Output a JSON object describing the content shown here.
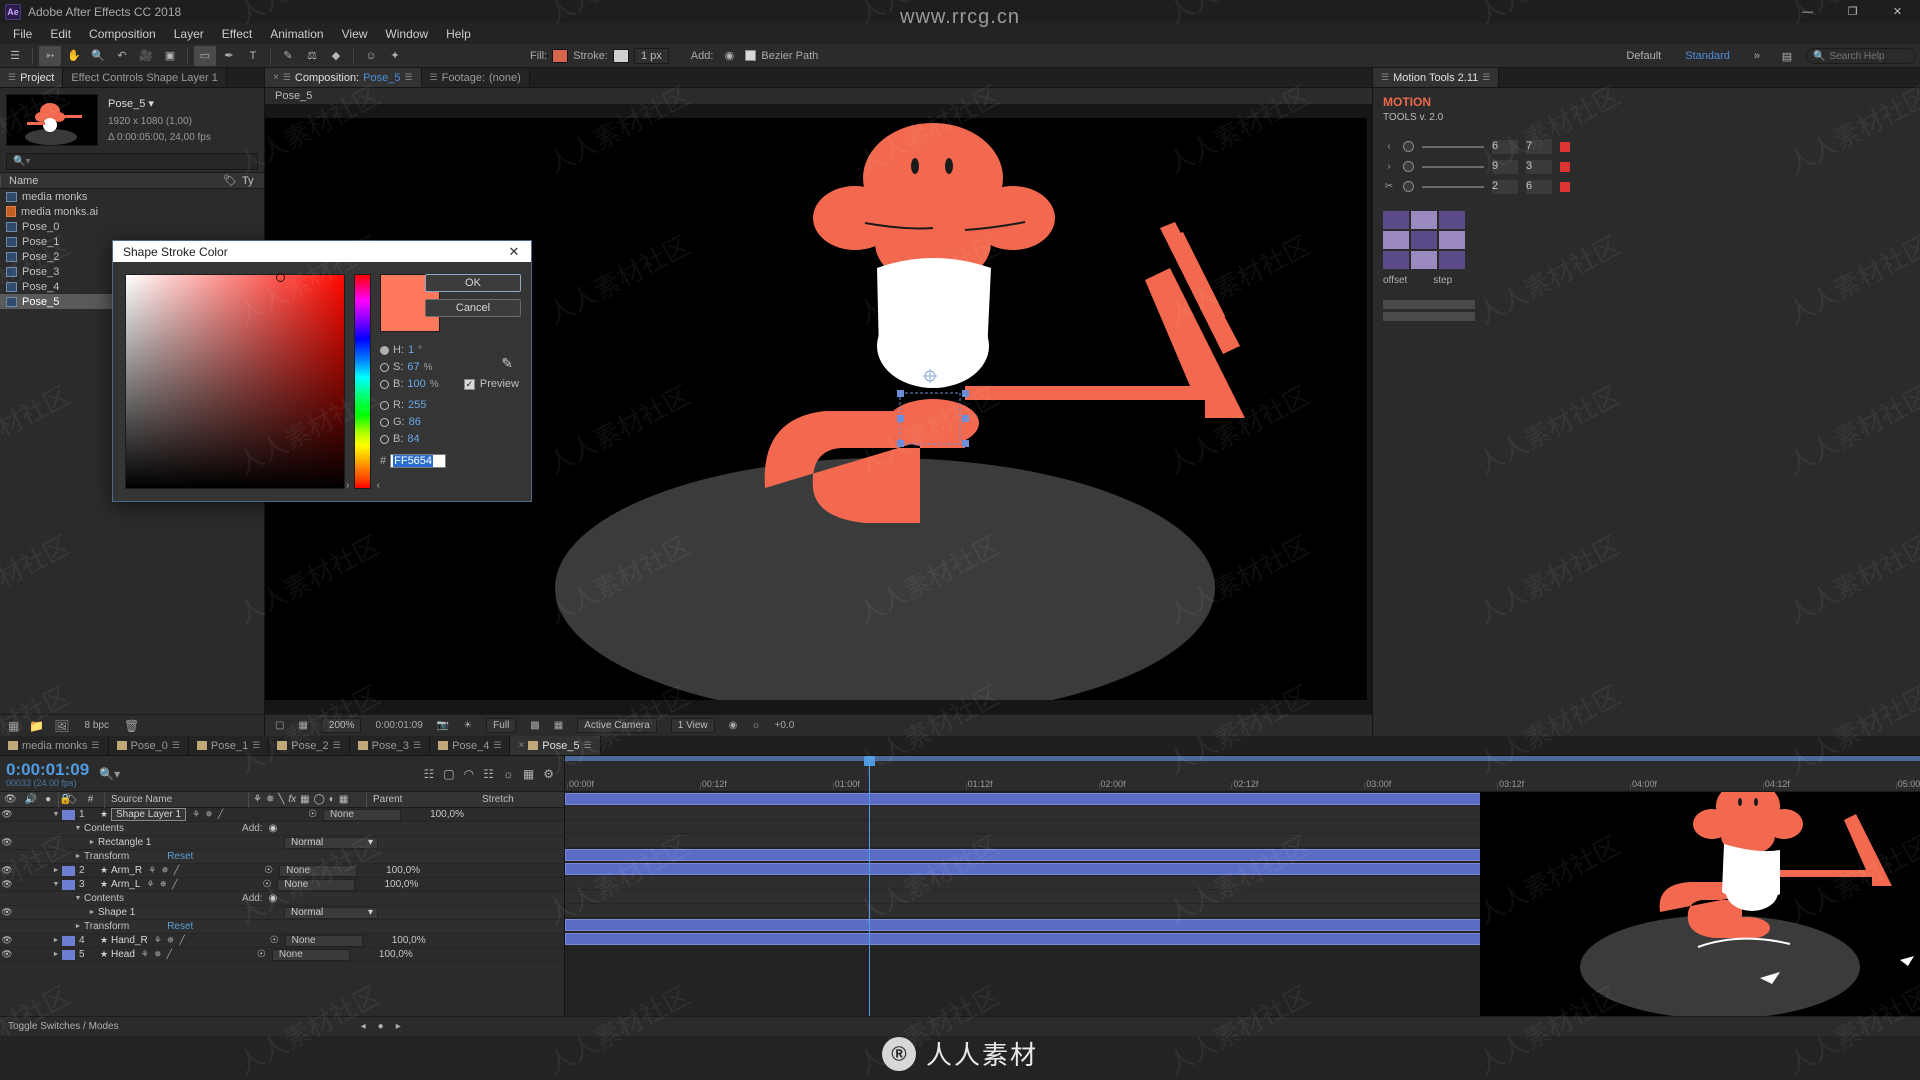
{
  "app": {
    "title": "Adobe After Effects CC 2018",
    "logo": "Ae",
    "window_buttons": {
      "minimize": "—",
      "maximize": "❐",
      "close": "✕"
    }
  },
  "menubar": {
    "items": [
      "File",
      "Edit",
      "Composition",
      "Layer",
      "Effect",
      "Animation",
      "View",
      "Window",
      "Help"
    ]
  },
  "toolbar": {
    "fill_label": "Fill:",
    "stroke_label": "Stroke:",
    "stroke_width": "1 px",
    "add_label": "Add:",
    "bezier_path": "Bezier Path",
    "fill_color": "#d4654f",
    "stroke_color": "#cfcfcf",
    "workspace_default": "Default",
    "workspace_standard": "Standard",
    "workspace_overflow": "»",
    "search_placeholder": "Search Help",
    "tools": [
      "selection-tool",
      "hand-tool",
      "zoom-tool",
      "rotation-tool",
      "camera-tool",
      "pan-behind-tool",
      "shape-tool",
      "pen-tool",
      "type-tool",
      "brush-tool",
      "clone-stamp-tool",
      "eraser-tool",
      "roto-brush-tool",
      "puppet-tool"
    ]
  },
  "project_panel": {
    "tabs": [
      {
        "label": "Project",
        "active": true
      },
      {
        "label": "Effect Controls Shape Layer 1",
        "active": false
      }
    ],
    "preview": {
      "name": "Pose_5",
      "dimensions": "1920 x 1080 (1,00)",
      "duration": "Δ 0:00:05:00, 24,00 fps"
    },
    "search_placeholder": "",
    "columns": {
      "name": "Name",
      "type": "Ty"
    },
    "items": [
      {
        "label": "media monks",
        "icon": "composition-icon",
        "selected": false
      },
      {
        "label": "media monks.ai",
        "icon": "illustrator-icon",
        "selected": false
      },
      {
        "label": "Pose_0",
        "icon": "composition-icon",
        "selected": false
      },
      {
        "label": "Pose_1",
        "icon": "composition-icon",
        "selected": false
      },
      {
        "label": "Pose_2",
        "icon": "composition-icon",
        "selected": false
      },
      {
        "label": "Pose_3",
        "icon": "composition-icon",
        "selected": false
      },
      {
        "label": "Pose_4",
        "icon": "composition-icon",
        "selected": false
      },
      {
        "label": "Pose_5",
        "icon": "composition-icon",
        "selected": true
      }
    ],
    "footer": {
      "bpc": "8 bpc"
    }
  },
  "comp_panel": {
    "tabs": [
      {
        "label": "Composition:",
        "name": "Pose_5",
        "active": true
      },
      {
        "label": "Footage:",
        "name": "(none)",
        "active": false
      }
    ],
    "breadcrumb": "Pose_5",
    "footer": {
      "magnification": "200%",
      "timecode": "0:00:01:09",
      "resolution": "Full",
      "view": "Active Camera",
      "views": "1 View",
      "exposure": "+0.0"
    }
  },
  "right_panel": {
    "tab_label": "Motion Tools 2.11",
    "title_line1": "MOTION",
    "title_line2": "TOOLS v. 2.0",
    "slider_rows": [
      {
        "arrow": "‹",
        "value_a": "6",
        "value_b": "7"
      },
      {
        "arrow": "›",
        "value_a": "9",
        "value_b": "3"
      },
      {
        "arrow": "✂",
        "value_a": "2",
        "value_b": "6"
      }
    ],
    "grid_labels": {
      "offset": "offset",
      "step": "step"
    }
  },
  "timeline": {
    "tabs": [
      {
        "label": "media monks",
        "active": false
      },
      {
        "label": "Pose_0",
        "active": false
      },
      {
        "label": "Pose_1",
        "active": false
      },
      {
        "label": "Pose_2",
        "active": false
      },
      {
        "label": "Pose_3",
        "active": false
      },
      {
        "label": "Pose_4",
        "active": false
      },
      {
        "label": "Pose_5",
        "active": true
      }
    ],
    "current_time": "0:00:01:09",
    "frames": "00033 (24.00 fps)",
    "columns": {
      "source_name": "Source Name",
      "parent": "Parent",
      "stretch": "Stretch",
      "hash": "#"
    },
    "ruler_ticks": [
      "00:00f",
      "00:12f",
      "01:00f",
      "01:12f",
      "02:00f",
      "02:12f",
      "03:00f",
      "03:12f",
      "04:00f",
      "04:12f",
      "05:00"
    ],
    "rows": [
      {
        "kind": "layer",
        "index": "1",
        "name": "Shape Layer 1",
        "parent": "None",
        "stretch": "100,0%",
        "expanded": true,
        "selected": true,
        "boxed": true
      },
      {
        "kind": "group",
        "label": "Contents",
        "add_label": "Add:",
        "expanded": true
      },
      {
        "kind": "shape",
        "label": "Rectangle 1",
        "mode": "Normal"
      },
      {
        "kind": "transform",
        "label": "Transform",
        "reset": "Reset"
      },
      {
        "kind": "layer",
        "index": "2",
        "name": "Arm_R",
        "parent": "None",
        "stretch": "100,0%",
        "expanded": false
      },
      {
        "kind": "layer",
        "index": "3",
        "name": "Arm_L",
        "parent": "None",
        "stretch": "100,0%",
        "expanded": true
      },
      {
        "kind": "group",
        "label": "Contents",
        "add_label": "Add:",
        "expanded": true
      },
      {
        "kind": "shape",
        "label": "Shape 1",
        "mode": "Normal"
      },
      {
        "kind": "transform",
        "label": "Transform",
        "reset": "Reset"
      },
      {
        "kind": "layer",
        "index": "4",
        "name": "Hand_R",
        "parent": "None",
        "stretch": "100,0%",
        "expanded": false
      },
      {
        "kind": "layer",
        "index": "5",
        "name": "Head",
        "parent": "None",
        "stretch": "100,0%",
        "expanded": false
      }
    ],
    "footer": {
      "toggle_switches": "Toggle Switches / Modes"
    }
  },
  "color_dialog": {
    "title": "Shape Stroke Color",
    "close_label": "✕",
    "ok_label": "OK",
    "cancel_label": "Cancel",
    "preview_label": "Preview",
    "preview_checked": true,
    "swatch_color": "#FF7A5C",
    "hsb": [
      {
        "label": "H:",
        "value": "1",
        "unit": "°",
        "selected": true
      },
      {
        "label": "S:",
        "value": "67",
        "unit": "%",
        "selected": false
      },
      {
        "label": "B:",
        "value": "100",
        "unit": "%",
        "selected": false
      }
    ],
    "rgb": [
      {
        "label": "R:",
        "value": "255",
        "unit": "",
        "selected": false
      },
      {
        "label": "G:",
        "value": "86",
        "unit": "",
        "selected": false
      },
      {
        "label": "B:",
        "value": "84",
        "unit": "",
        "selected": false
      }
    ],
    "hex_prefix": "#",
    "hex_value": "FF5654",
    "eyedropper": "eyedropper-icon"
  },
  "watermarks": {
    "top": "www.rrcg.cn",
    "bottom_logo": "Ⓡ",
    "bottom_text": "人人素材",
    "tile_text": "人人素材社区"
  },
  "theme": {
    "accent_blue": "#4f9ae0",
    "char_orange": "#f2694f",
    "panel_bg": "#2b2b2b",
    "layer_bar": "#5b6cc4"
  }
}
